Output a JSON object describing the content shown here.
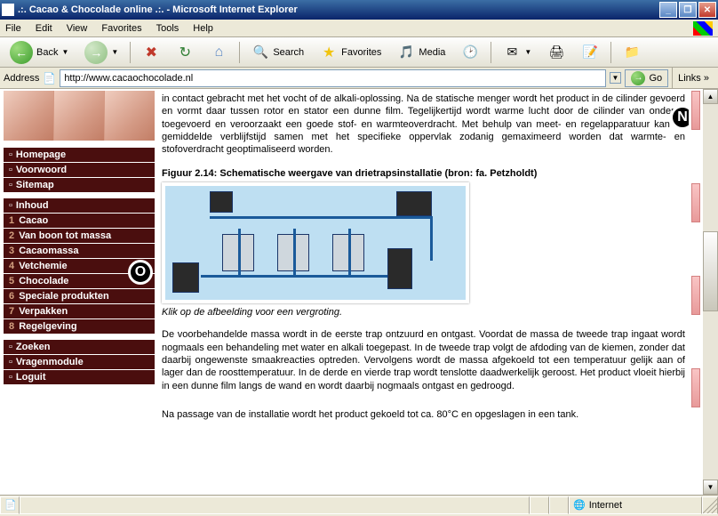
{
  "window": {
    "title": ".:. Cacao & Chocolade online .:. - Microsoft Internet Explorer"
  },
  "winbuttons": {
    "min": "_",
    "max": "❐",
    "close": "✕"
  },
  "menu": {
    "file": "File",
    "edit": "Edit",
    "view": "View",
    "favorites": "Favorites",
    "tools": "Tools",
    "help": "Help"
  },
  "toolbar": {
    "back": "Back",
    "search": "Search",
    "favorites": "Favorites",
    "media": "Media"
  },
  "address": {
    "label": "Address",
    "url": "http://www.cacaochocolade.nl",
    "go": "Go",
    "links": "Links"
  },
  "nav": {
    "block1": [
      {
        "prefix": "▫",
        "label": "Homepage"
      },
      {
        "prefix": "▫",
        "label": "Voorwoord"
      },
      {
        "prefix": "▫",
        "label": "Sitemap"
      }
    ],
    "block2": [
      {
        "prefix": "▫",
        "label": "Inhoud"
      },
      {
        "prefix": "1",
        "label": "Cacao"
      },
      {
        "prefix": "2",
        "label": "Van boon tot massa"
      },
      {
        "prefix": "3",
        "label": "Cacaomassa"
      },
      {
        "prefix": "4",
        "label": "Vetchemie"
      },
      {
        "prefix": "5",
        "label": "Chocolade"
      },
      {
        "prefix": "6",
        "label": "Speciale produkten"
      },
      {
        "prefix": "7",
        "label": "Verpakken"
      },
      {
        "prefix": "8",
        "label": "Regelgeving"
      }
    ],
    "block3": [
      {
        "prefix": "▫",
        "label": "Zoeken"
      },
      {
        "prefix": "▫",
        "label": "Vragenmodule"
      },
      {
        "prefix": "▫",
        "label": "Loguit"
      }
    ]
  },
  "main": {
    "para1": "in contact gebracht met het vocht of de alkali-oplossing. Na de statische menger wordt het product in de cilinder gevoerd en vormt daar tussen rotor en stator een dunne film. Tegelijkertijd wordt warme lucht door de cilinder van onderen toegevoerd en veroorzaakt een goede stof- en warmteoverdracht. Met behulp van meet- en regelapparatuur kan de gemiddelde verblijfstijd samen met het specifieke oppervlak zodanig gemaximeerd worden dat warmte- en stofoverdracht geoptimaliseerd worden.",
    "figcaption": "Figuur 2.14: Schematische weergave van drietrapsinstallatie (bron: fa. Petzholdt)",
    "figclick": "Klik op de afbeelding voor een vergroting.",
    "para2": "De voorbehandelde massa wordt in de eerste trap ontzuurd en ontgast. Voordat de massa de tweede trap ingaat wordt nogmaals een behandeling met water en alkali toegepast. In de tweede trap volgt de afdoding van de kiemen, zonder dat daarbij ongewenste smaakreacties optreden. Vervolgens wordt de massa afgekoeld tot een temperatuur gelijk aan of lager dan de roosttemperatuur. In de derde en vierde trap wordt tenslotte daadwerkelijk geroost. Het product vloeit hierbij in een dunne film langs de wand en wordt daarbij nogmaals ontgast en gedroogd.",
    "para3": "Na passage van de installatie wordt het product gekoeld tot ca. 80°C en opgeslagen in een tank."
  },
  "status": {
    "zone": "Internet"
  },
  "markers": {
    "n": "N",
    "o": "O"
  }
}
